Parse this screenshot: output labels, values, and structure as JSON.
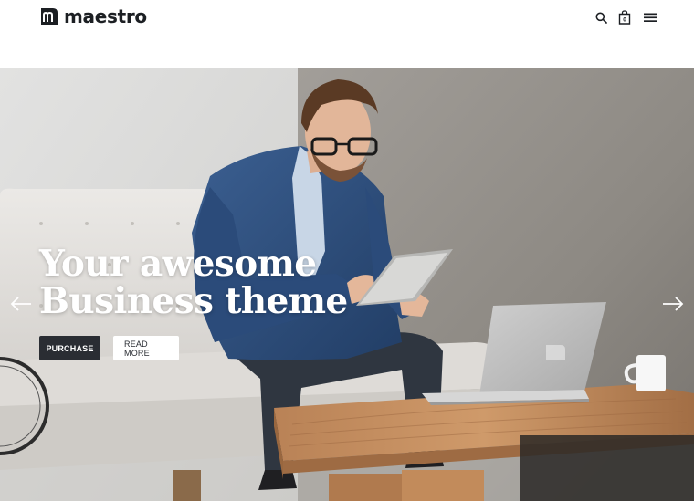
{
  "header": {
    "brand_name": "maestro",
    "brand_logo_icon": "maestro-m-logo-icon",
    "icons": {
      "search": "search-icon",
      "cart": "shopping-bag-icon",
      "menu": "hamburger-menu-icon"
    },
    "cart_count": "0"
  },
  "hero": {
    "heading_line1": "Your awesome",
    "heading_line2": "Business theme",
    "purchase_label": "PURCHASE",
    "read_more_label": "READ MORE",
    "prev_icon": "arrow-left-icon",
    "next_icon": "arrow-right-icon"
  },
  "colors": {
    "brand_dark": "#1c1f23",
    "button_dark": "#2a2d33",
    "wall_left": "#d9d9d9",
    "wall_right": "#8e8a84",
    "sofa": "#e6e4e0",
    "table_wood": "#c48e5e"
  }
}
